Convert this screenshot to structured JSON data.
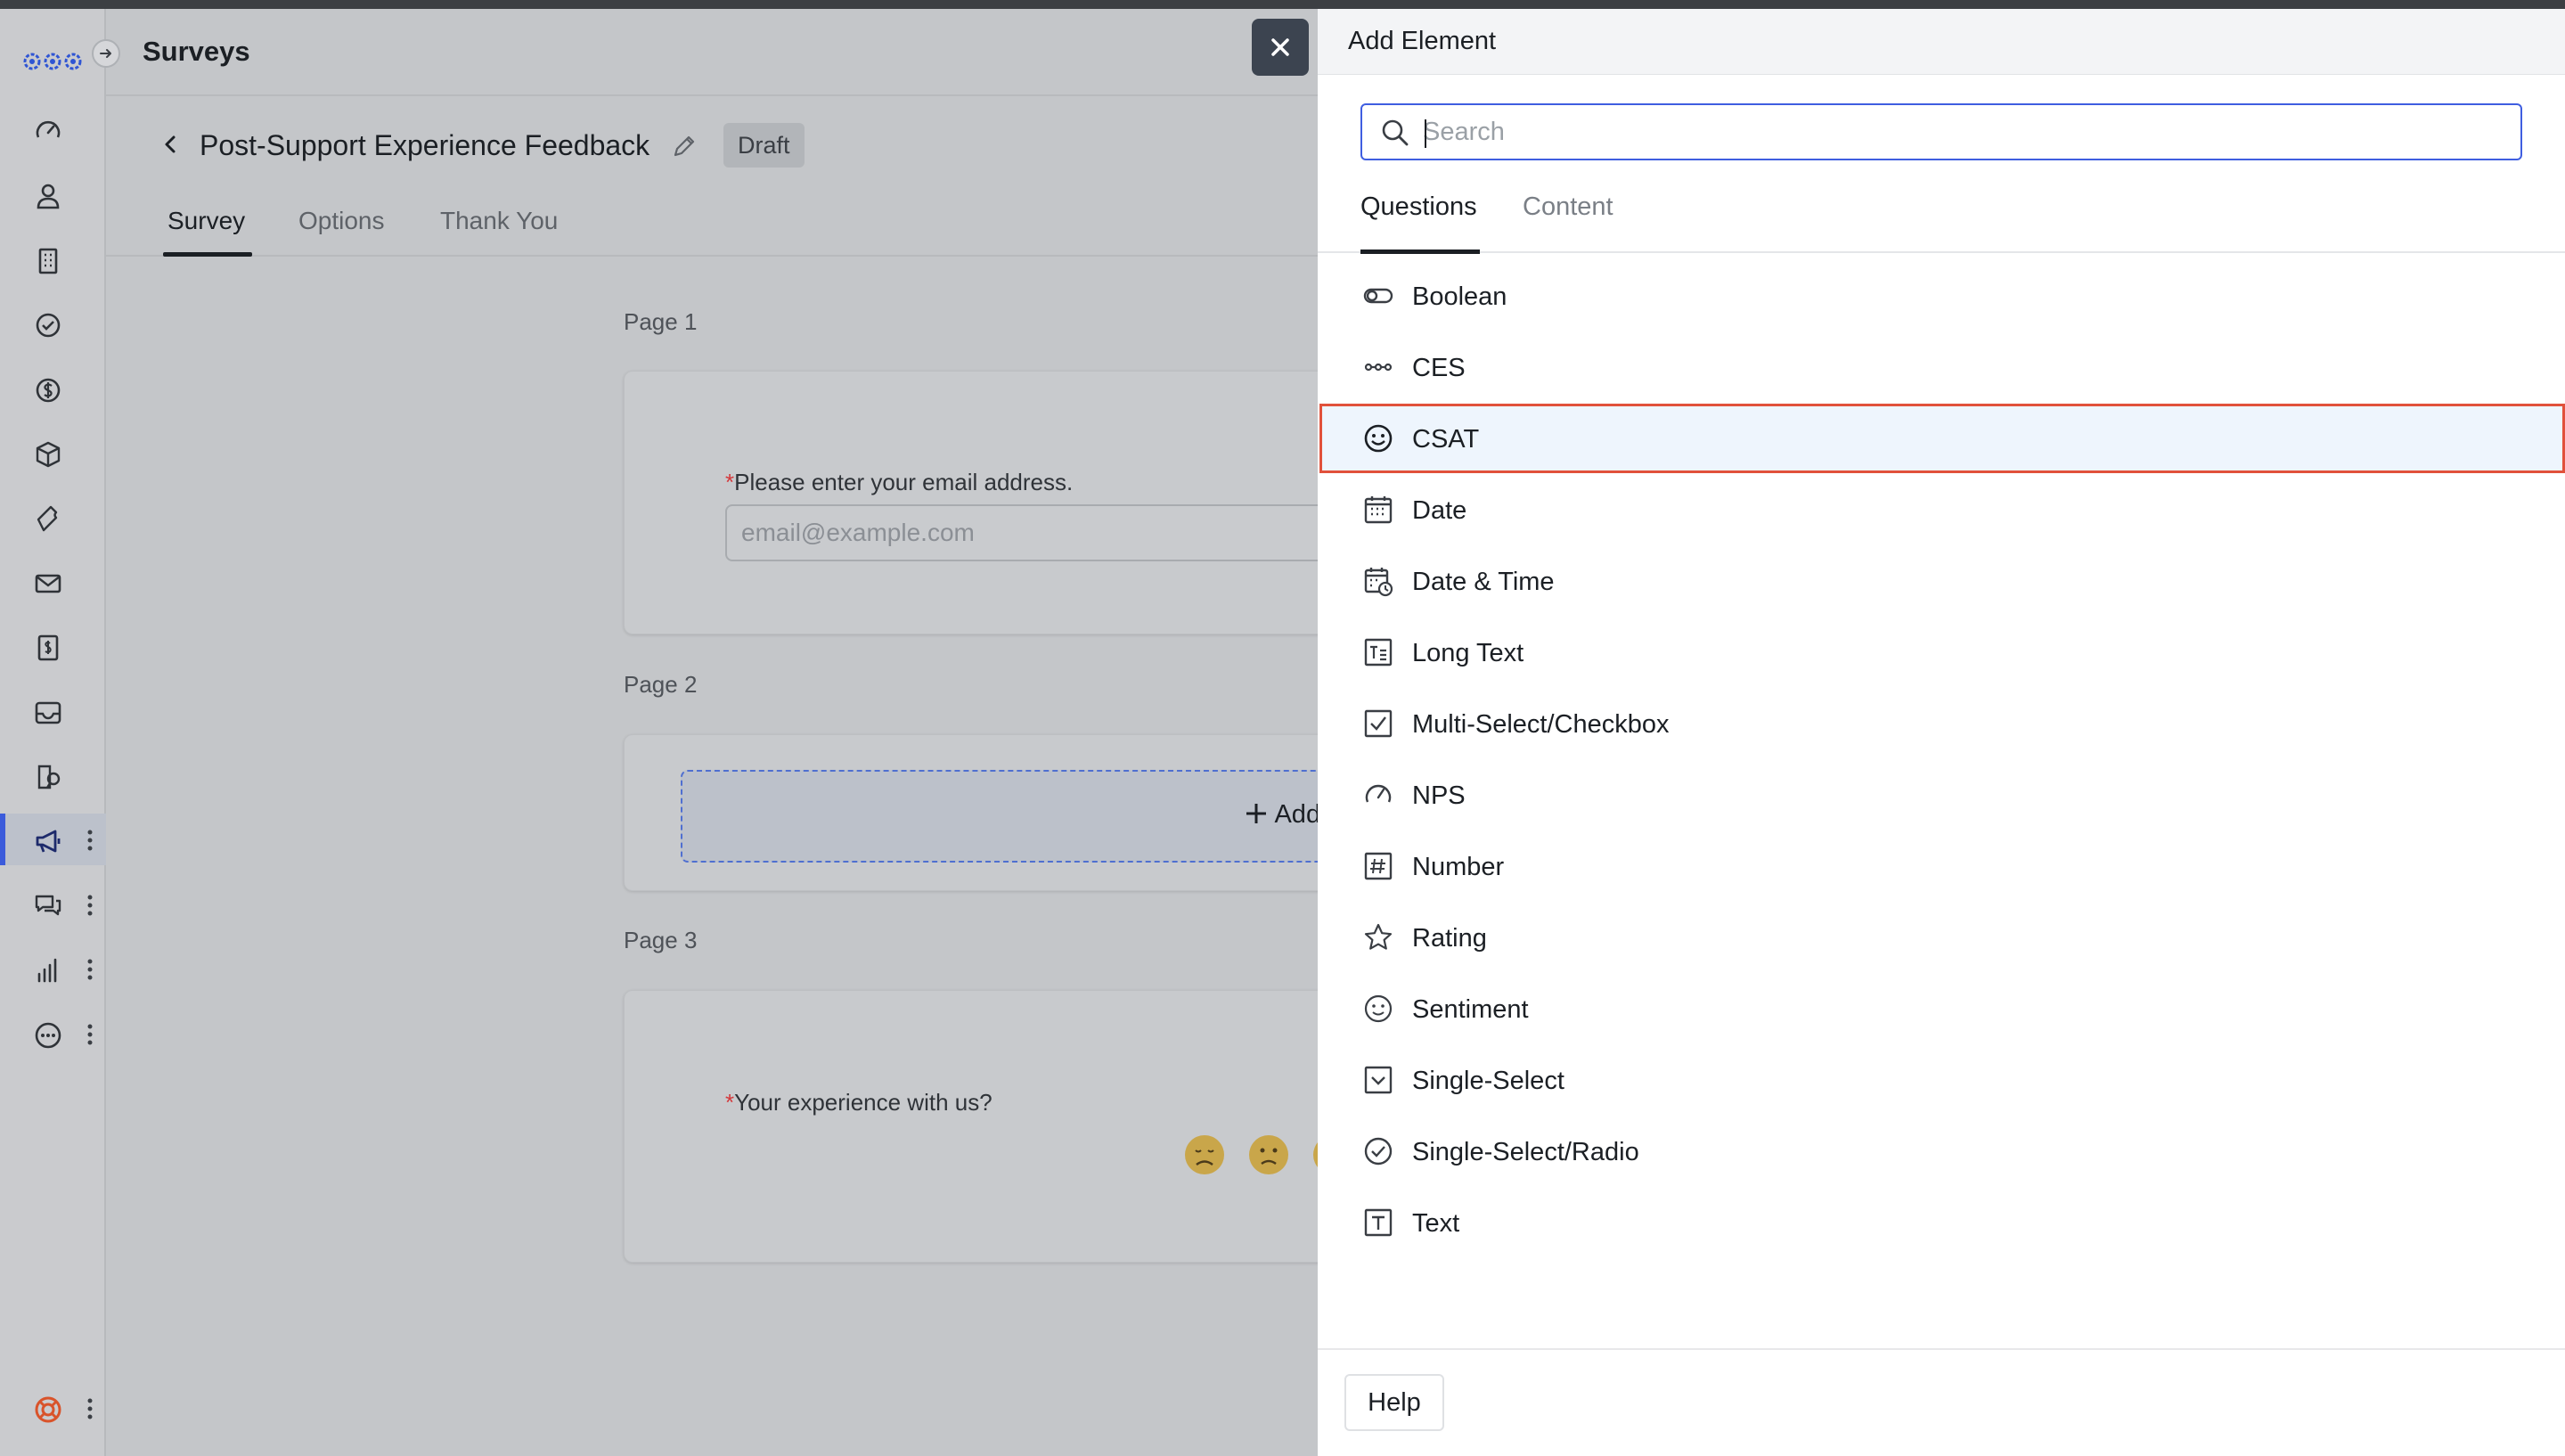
{
  "app": {
    "title": "Surveys"
  },
  "sidebar": {
    "items": [
      {
        "icon": "dashboard-gauge-icon"
      },
      {
        "icon": "person-icon"
      },
      {
        "icon": "building-icon"
      },
      {
        "icon": "check-circle-icon"
      },
      {
        "icon": "dollar-circle-icon"
      },
      {
        "icon": "cube-icon"
      },
      {
        "icon": "ticket-icon"
      },
      {
        "icon": "mail-icon"
      },
      {
        "icon": "invoice-icon"
      },
      {
        "icon": "inbox-icon"
      },
      {
        "icon": "knowledge-icon"
      },
      {
        "icon": "megaphone-icon",
        "active": true
      },
      {
        "icon": "chat-icon"
      },
      {
        "icon": "bar-chart-icon"
      },
      {
        "icon": "more-circle-icon"
      }
    ],
    "footer_icon": "lifebuoy-icon"
  },
  "survey": {
    "name": "Post-Support Experience Feedback",
    "status": "Draft",
    "tabs": [
      "Survey",
      "Options",
      "Thank You"
    ],
    "active_tab": "Survey",
    "pages": [
      {
        "label": "Page 1",
        "question": "Please enter your email address.",
        "required": "*",
        "placeholder": "email@example.com"
      },
      {
        "label": "Page 2",
        "dropzone": "Add"
      },
      {
        "label": "Page 3",
        "question": "Your experience with us?",
        "required": "*"
      }
    ]
  },
  "panel": {
    "title": "Add Element",
    "search_placeholder": "Search",
    "tabs": [
      "Questions",
      "Content"
    ],
    "active_tab": "Questions",
    "items": [
      {
        "label": "Boolean",
        "icon": "toggle-icon"
      },
      {
        "label": "CES",
        "icon": "ces-scale-icon"
      },
      {
        "label": "CSAT",
        "icon": "smiley-icon",
        "selected": true
      },
      {
        "label": "Date",
        "icon": "calendar-icon"
      },
      {
        "label": "Date & Time",
        "icon": "calendar-clock-icon"
      },
      {
        "label": "Long Text",
        "icon": "long-text-icon"
      },
      {
        "label": "Multi-Select/Checkbox",
        "icon": "checkbox-icon"
      },
      {
        "label": "NPS",
        "icon": "gauge-icon"
      },
      {
        "label": "Number",
        "icon": "hash-icon"
      },
      {
        "label": "Rating",
        "icon": "star-icon"
      },
      {
        "label": "Sentiment",
        "icon": "sentiment-icon"
      },
      {
        "label": "Single-Select",
        "icon": "dropdown-box-icon"
      },
      {
        "label": "Single-Select/Radio",
        "icon": "radio-check-icon"
      },
      {
        "label": "Text",
        "icon": "text-box-icon"
      }
    ],
    "help_label": "Help"
  },
  "colors": {
    "accent": "#3f5ee0",
    "selection_outline": "#e1513b",
    "selected_bg": "#eef5fd",
    "required": "#d4383b"
  }
}
